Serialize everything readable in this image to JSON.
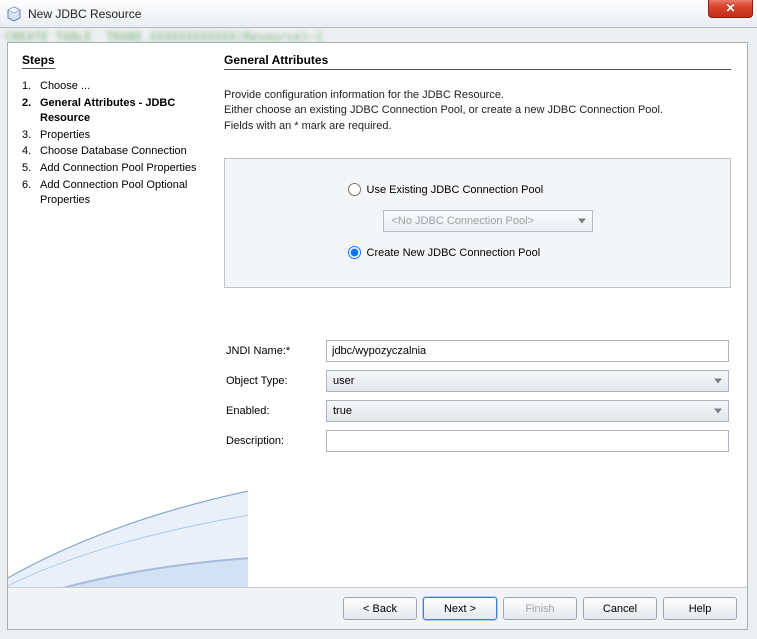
{
  "window": {
    "title": "New JDBC Resource"
  },
  "sidebar": {
    "heading": "Steps",
    "current_index": 1,
    "items": [
      {
        "num": "1.",
        "label": "Choose ..."
      },
      {
        "num": "2.",
        "label": "General Attributes - JDBC Resource"
      },
      {
        "num": "3.",
        "label": "Properties"
      },
      {
        "num": "4.",
        "label": "Choose Database Connection"
      },
      {
        "num": "5.",
        "label": "Add Connection Pool Properties"
      },
      {
        "num": "6.",
        "label": "Add Connection Pool Optional Properties"
      }
    ]
  },
  "main": {
    "heading": "General Attributes",
    "intro_line1": "Provide configuration information for the JDBC Resource.",
    "intro_line2": "Either choose an existing JDBC Connection Pool, or create a new JDBC Connection Pool.",
    "intro_line3": "Fields with an * mark are required."
  },
  "pool": {
    "use_existing_label": "Use Existing JDBC Connection Pool",
    "create_new_label": "Create New JDBC Connection Pool",
    "selected": "create_new",
    "dropdown_placeholder": "<No JDBC Connection Pool>"
  },
  "fields": {
    "jndi_label": "JNDI Name:*",
    "jndi_value": "jdbc/wypozyczalnia",
    "object_type_label": "Object Type:",
    "object_type_value": "user",
    "enabled_label": "Enabled:",
    "enabled_value": "true",
    "description_label": "Description:",
    "description_value": ""
  },
  "buttons": {
    "back": "< Back",
    "next": "Next >",
    "finish": "Finish",
    "cancel": "Cancel",
    "help": "Help"
  }
}
